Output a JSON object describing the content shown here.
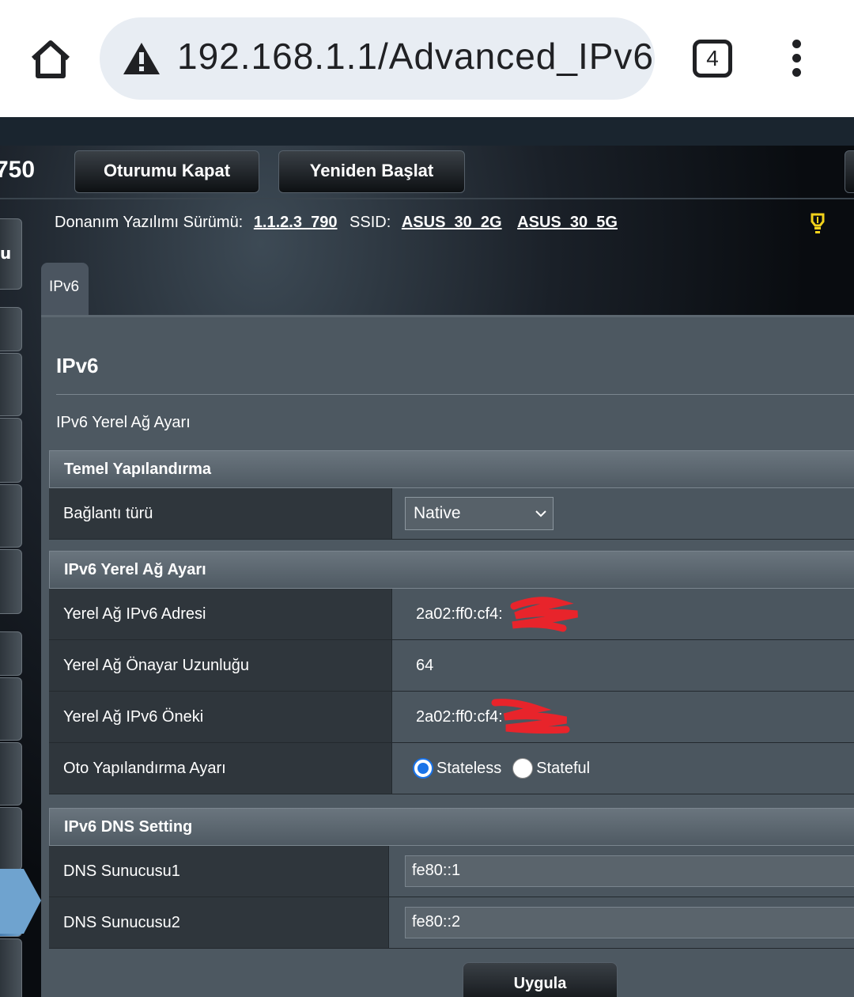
{
  "browser": {
    "url": "192.168.1.1/Advanced_IPv6_",
    "tab_count": "4"
  },
  "header": {
    "model": "750",
    "logout_label": "Oturumu Kapat",
    "reboot_label": "Yeniden Başlat",
    "firmware_label": "Donanım Yazılımı Sürümü:",
    "firmware_version": "1.1.2.3_790",
    "ssid_label": "SSID:",
    "ssid_2g": "ASUS_30_2G",
    "ssid_5g": "ASUS_30_5G"
  },
  "sidebar": {
    "label": "u"
  },
  "tab": {
    "label": "IPv6"
  },
  "page": {
    "title": "IPv6",
    "subtitle": "IPv6 Yerel Ağ Ayarı"
  },
  "basic": {
    "header": "Temel Yapılandırma",
    "conn_type_label": "Bağlantı türü",
    "conn_type_value": "Native"
  },
  "lan": {
    "header": "IPv6 Yerel Ağ Ayarı",
    "address_label": "Yerel Ağ IPv6 Adresi",
    "address_value": "2a02:ff0:cf4:",
    "prefix_len_label": "Yerel Ağ Önayar Uzunluğu",
    "prefix_len_value": "64",
    "prefix_label": "Yerel Ağ IPv6 Öneki",
    "prefix_value": "2a02:ff0:cf4:",
    "autoconf_label": "Oto Yapılandırma Ayarı",
    "autoconf_options": [
      "Stateless",
      "Stateful"
    ],
    "autoconf_selected": "Stateless"
  },
  "dns": {
    "header": "IPv6 DNS Setting",
    "dns1_label": "DNS Sunucusu1",
    "dns1_value": "fe80::1",
    "dns2_label": "DNS Sunucusu2",
    "dns2_value": "fe80::2"
  },
  "apply_label": "Uygula",
  "colors": {
    "accent": "#1a73e8",
    "panel": "#4d5861",
    "redaction": "#e8242b"
  },
  "icons": [
    "home-icon",
    "warning-icon",
    "tab-switcher-icon",
    "more-menu-icon",
    "lightbulb-icon",
    "chevron-down-icon"
  ]
}
